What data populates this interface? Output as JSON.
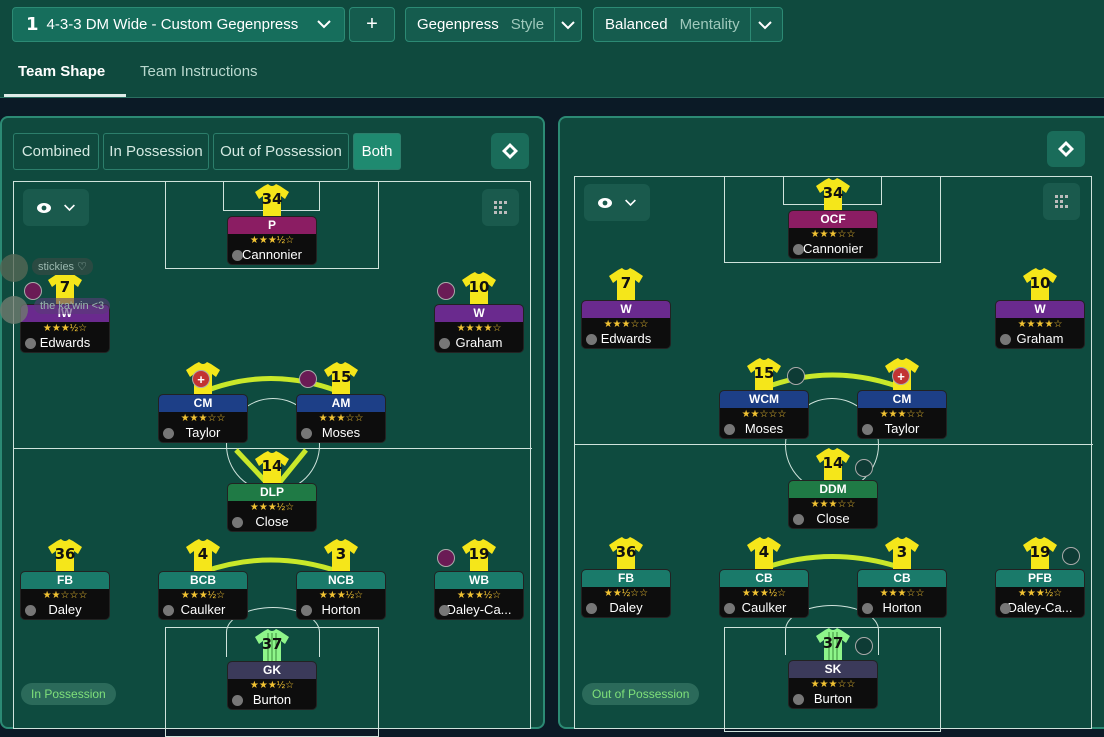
{
  "header": {
    "tactic_number": "1",
    "tactic_name": "4-3-3 DM Wide - Custom Gegenpress",
    "add_label": "+",
    "style_value": "Gegenpress",
    "style_label": "Style",
    "mentality_value": "Balanced",
    "mentality_label": "Mentality"
  },
  "tabs": {
    "active": "Team Shape",
    "other": "Team Instructions"
  },
  "phase_buttons": [
    "Combined",
    "In Possession",
    "Out of Possession",
    "Both"
  ],
  "overlay": {
    "chat1": "stickies ♡",
    "chat2": "the ka'win <3"
  },
  "left": {
    "mode": "In Possession",
    "players": [
      {
        "num": "34",
        "role": "P",
        "stars": "★★★½☆",
        "name": "Cannonier"
      },
      {
        "num": "7",
        "role": "IW",
        "stars": "★★★½☆",
        "name": "Edwards"
      },
      {
        "num": "10",
        "role": "W",
        "stars": "★★★★☆",
        "name": "Graham"
      },
      {
        "num": "",
        "role": "CM",
        "stars": "★★★☆☆",
        "name": "Taylor"
      },
      {
        "num": "15",
        "role": "AM",
        "stars": "★★★☆☆",
        "name": "Moses"
      },
      {
        "num": "14",
        "role": "DLP",
        "stars": "★★★½☆",
        "name": "Close"
      },
      {
        "num": "36",
        "role": "FB",
        "stars": "★★☆☆☆",
        "name": "Daley"
      },
      {
        "num": "4",
        "role": "BCB",
        "stars": "★★★½☆",
        "name": "Caulker"
      },
      {
        "num": "3",
        "role": "NCB",
        "stars": "★★★½☆",
        "name": "Horton"
      },
      {
        "num": "19",
        "role": "WB",
        "stars": "★★★½☆",
        "name": "Daley-Ca..."
      },
      {
        "num": "37",
        "role": "GK",
        "stars": "★★★½☆",
        "name": "Burton"
      }
    ]
  },
  "right": {
    "mode": "Out of Possession",
    "players": [
      {
        "num": "34",
        "role": "OCF",
        "stars": "★★★☆☆",
        "name": "Cannonier"
      },
      {
        "num": "7",
        "role": "W",
        "stars": "★★★☆☆",
        "name": "Edwards"
      },
      {
        "num": "10",
        "role": "W",
        "stars": "★★★★☆",
        "name": "Graham"
      },
      {
        "num": "15",
        "role": "WCM",
        "stars": "★★☆☆☆",
        "name": "Moses"
      },
      {
        "num": "",
        "role": "CM",
        "stars": "★★★☆☆",
        "name": "Taylor"
      },
      {
        "num": "14",
        "role": "DDM",
        "stars": "★★★☆☆",
        "name": "Close"
      },
      {
        "num": "36",
        "role": "FB",
        "stars": "★★½☆☆",
        "name": "Daley"
      },
      {
        "num": "4",
        "role": "CB",
        "stars": "★★★½☆",
        "name": "Caulker"
      },
      {
        "num": "3",
        "role": "CB",
        "stars": "★★★☆☆",
        "name": "Horton"
      },
      {
        "num": "19",
        "role": "PFB",
        "stars": "★★★½☆",
        "name": "Daley-Ca..."
      },
      {
        "num": "37",
        "role": "SK",
        "stars": "★★★☆☆",
        "name": "Burton"
      }
    ]
  },
  "colors": {
    "attack": "#8b1d63",
    "wide": "#6a2a8e",
    "mid": "#1d3f87",
    "dm": "#1f7a45",
    "def": "#1a7a6a",
    "gk": "#3b3a5a",
    "shirt": "#f5e61a",
    "gk_shirt": "#8ef58a",
    "link": "#c9e82a"
  }
}
